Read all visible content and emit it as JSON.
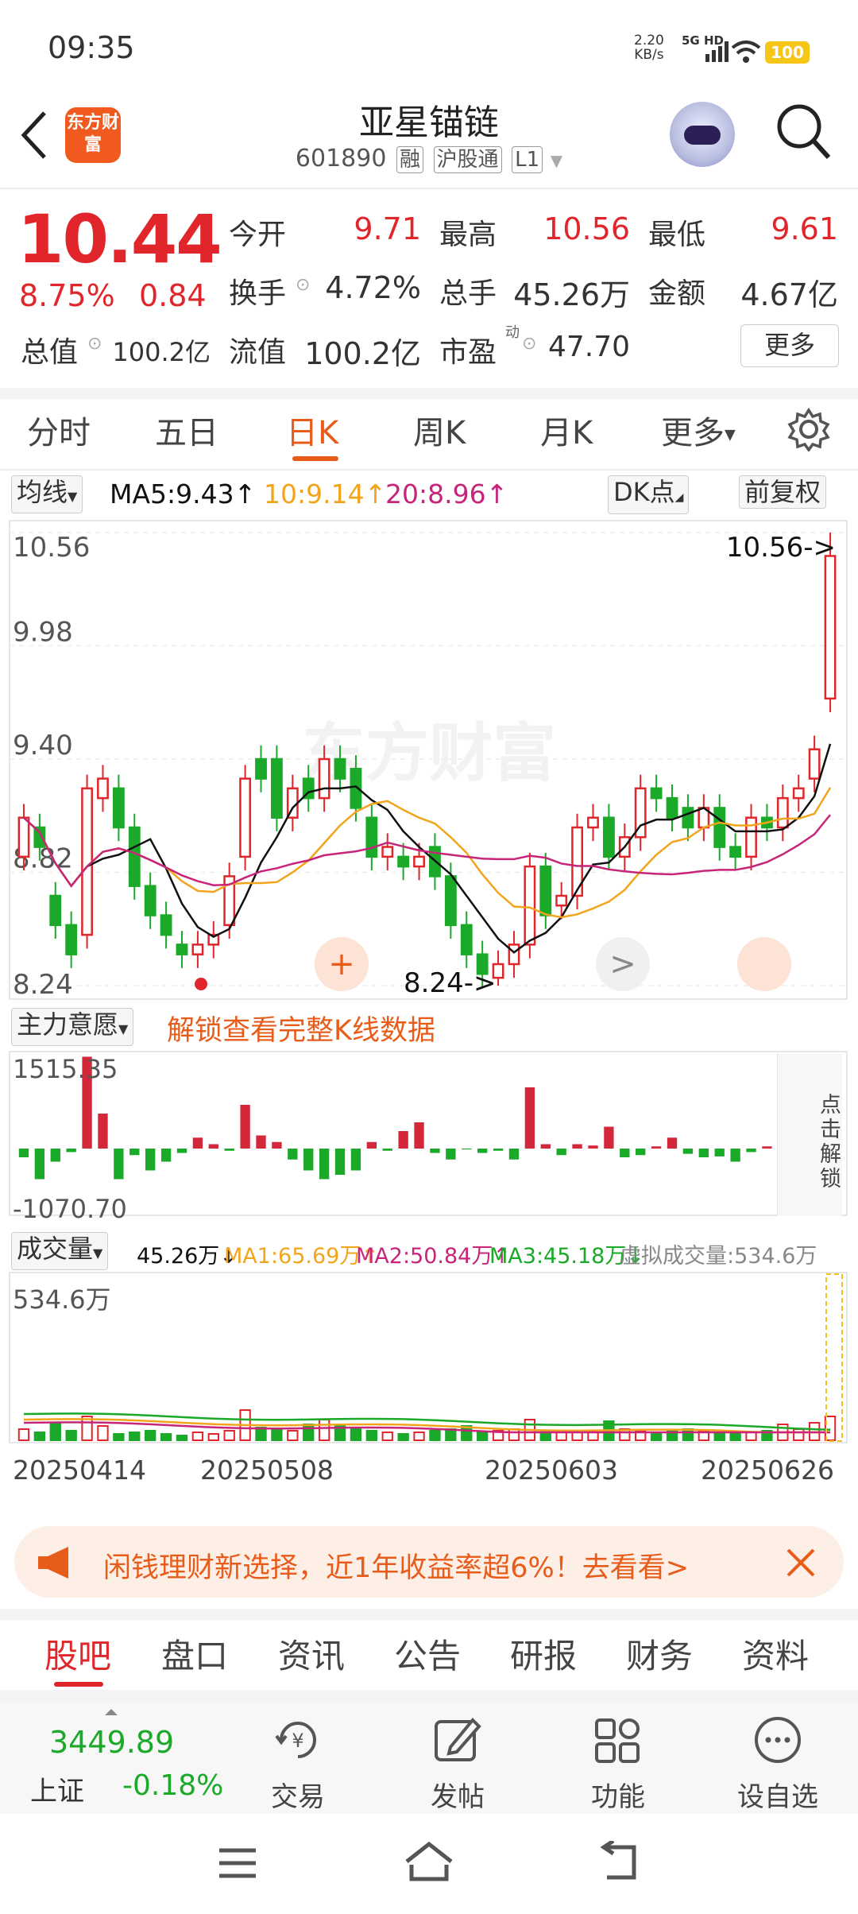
{
  "status": {
    "time": "09:35",
    "net_speed": "2.20",
    "net_unit": "KB/s",
    "network": "5G HD",
    "battery": "100"
  },
  "header": {
    "logo_text": "东方财富",
    "title": "亚星锚链",
    "code": "601890",
    "tags": [
      "融",
      "沪股通",
      "L1"
    ]
  },
  "quote": {
    "price": "10.44",
    "change_pct": "8.75%",
    "change": "0.84",
    "rows": [
      [
        {
          "label": "今开",
          "value": "9.71",
          "color": "red"
        },
        {
          "label": "最高",
          "value": "10.56",
          "color": "red"
        },
        {
          "label": "最低",
          "value": "9.61",
          "color": "red"
        }
      ],
      [
        {
          "label": "换手",
          "value": "4.72%",
          "color": "blk"
        },
        {
          "label": "总手",
          "value": "45.26万",
          "color": "blk"
        },
        {
          "label": "金额",
          "value": "4.67亿",
          "color": "blk"
        }
      ],
      [
        {
          "label": "总值",
          "value": "100.2亿",
          "color": "blk"
        },
        {
          "label": "流值",
          "value": "100.2亿",
          "color": "blk"
        },
        {
          "label": "市盈",
          "value": "47.70",
          "color": "blk"
        }
      ]
    ],
    "pe_sup": "动",
    "more": "更多"
  },
  "period_tabs": [
    "分时",
    "五日",
    "日K",
    "周K",
    "月K",
    "更多"
  ],
  "ma": {
    "button": "均线",
    "ma5": "MA5:9.43",
    "ma10": "10:9.14",
    "ma20": "20:8.96",
    "dk_button": "DK点",
    "adj_button": "前复权"
  },
  "kline": {
    "y_labels": [
      "10.56",
      "9.98",
      "9.40",
      "8.82",
      "8.24"
    ],
    "high_note": "10.56->",
    "low_note": "8.24->",
    "watermark": "东方财富",
    "markers": [
      "+",
      ">"
    ],
    "colors": {
      "up": "#e0262b",
      "down": "#1aa928",
      "ma5": "#111111",
      "ma10": "#f2a51c",
      "ma20": "#c7247a"
    }
  },
  "indicator": {
    "button": "主力意愿",
    "unlock": "解锁查看完整K线数据",
    "max": "1515.35",
    "min": "-1070.70",
    "side_unlock": "点击解锁"
  },
  "volume": {
    "button": "成交量",
    "vol": "45.26万",
    "ma1": "MA1:65.69万",
    "ma2": "MA2:50.84万",
    "ma3": "MA3:45.18万",
    "virtual": "虚拟成交量:534.6万",
    "max": "534.6万"
  },
  "dates": [
    "20250414",
    "20250508",
    "20250603",
    "20250626"
  ],
  "ad": {
    "text": "闲钱理财新选择，近1年收益率超6%！去看看>"
  },
  "bottom_tabs": [
    "股吧",
    "盘口",
    "资讯",
    "公告",
    "研报",
    "财务",
    "资料"
  ],
  "footer": {
    "index_value": "3449.89",
    "index_name": "上证",
    "index_change": "-0.18%",
    "actions": [
      "交易",
      "发帖",
      "功能",
      "设自选"
    ]
  }
}
